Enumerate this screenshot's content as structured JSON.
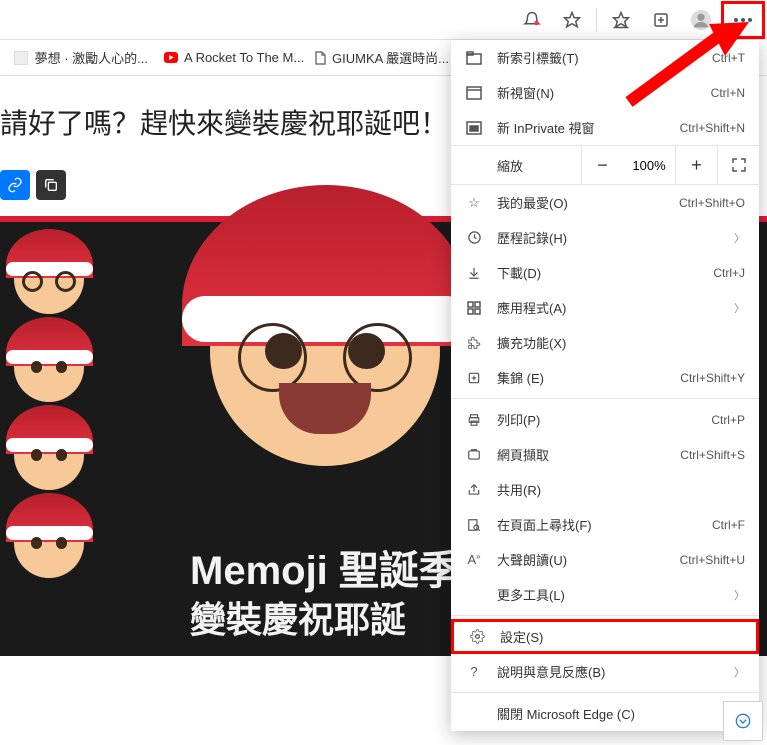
{
  "toolbar": {
    "icons": [
      "notifications-icon",
      "favorite-star-icon",
      "favorites-list-icon",
      "collections-icon",
      "profile-icon",
      "more-icon"
    ]
  },
  "tabs": [
    {
      "favicon": "blank",
      "label": "夢想 · 激勵人心的..."
    },
    {
      "favicon": "youtube",
      "label": "A Rocket To The M..."
    },
    {
      "favicon": "page",
      "label": "GIUMKA 嚴選時尚..."
    }
  ],
  "page": {
    "headline": "請好了嗎？趕快來變裝慶祝耶誕吧！",
    "hero_title": "Memoji 聖誕季",
    "hero_sub": "變裝慶祝耶誕"
  },
  "menu": {
    "new_tab": "新索引標籤(T)",
    "new_tab_sc": "Ctrl+T",
    "new_window": "新視窗(N)",
    "new_window_sc": "Ctrl+N",
    "new_inprivate": "新 InPrivate 視窗",
    "new_inprivate_sc": "Ctrl+Shift+N",
    "zoom": "縮放",
    "zoom_val": "100%",
    "favorites": "我的最愛(O)",
    "favorites_sc": "Ctrl+Shift+O",
    "history": "歷程記錄(H)",
    "downloads": "下載(D)",
    "downloads_sc": "Ctrl+J",
    "apps": "應用程式(A)",
    "extensions": "擴充功能(X)",
    "collections": "集錦 (E)",
    "collections_sc": "Ctrl+Shift+Y",
    "print": "列印(P)",
    "print_sc": "Ctrl+P",
    "webcapture": "網頁擷取",
    "webcapture_sc": "Ctrl+Shift+S",
    "share": "共用(R)",
    "find": "在頁面上尋找(F)",
    "find_sc": "Ctrl+F",
    "readaloud": "大聲朗讀(U)",
    "readaloud_sc": "Ctrl+Shift+U",
    "moretools": "更多工具(L)",
    "settings": "設定(S)",
    "help": "說明與意見反應(B)",
    "close": "關閉 Microsoft Edge (C)"
  }
}
